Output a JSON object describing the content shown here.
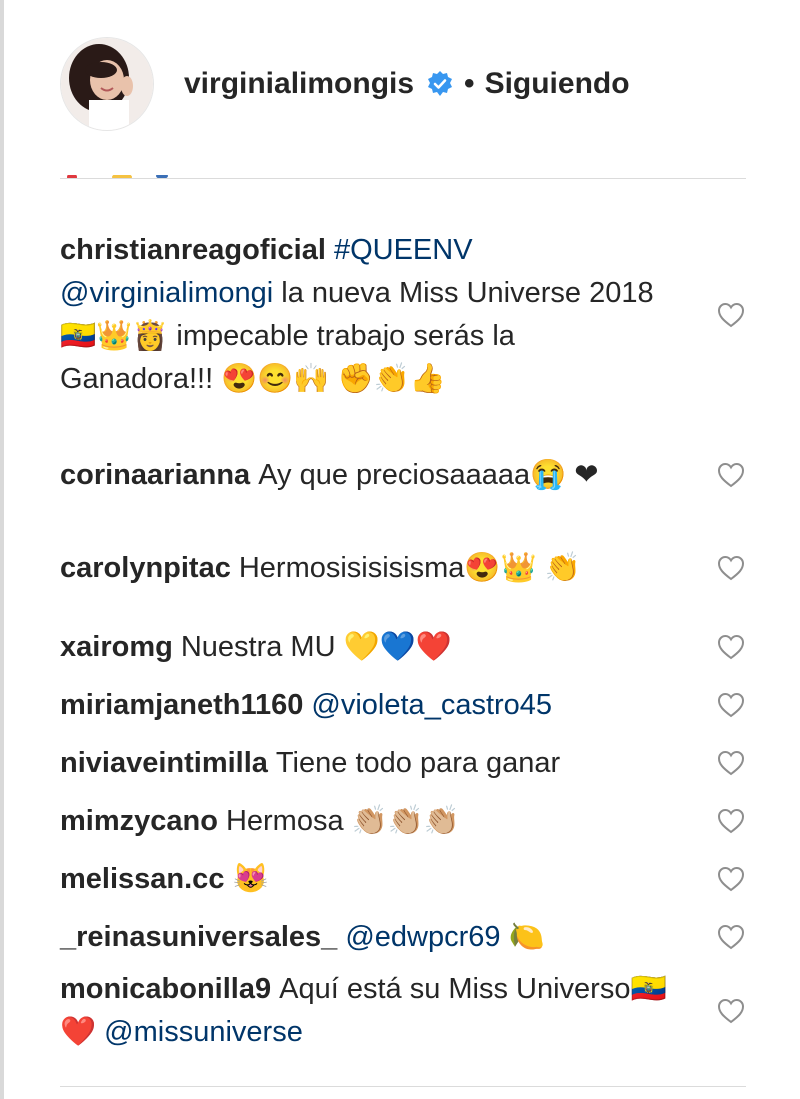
{
  "header": {
    "username": "virginialimongis",
    "separator": "•",
    "follow_status": "Siguiendo"
  },
  "comments": [
    {
      "user": "christianreagoficial",
      "parts": [
        {
          "type": "mention",
          "text": "#QUEENV"
        },
        {
          "type": "text",
          "text": " "
        },
        {
          "type": "mention",
          "text": "@virginialimongi"
        },
        {
          "type": "text",
          "text": " la nueva Miss Universe 2018 🇪🇨👑👸 impecable trabajo serás la Ganadora!!! 😍😊🙌 ✊👏👍"
        }
      ]
    },
    {
      "user": "corinaarianna",
      "parts": [
        {
          "type": "text",
          "text": "Ay que preciosaaaaa😭 ❤"
        }
      ]
    },
    {
      "user": "carolynpitac",
      "parts": [
        {
          "type": "text",
          "text": "Hermosisisisisma😍👑 👏"
        }
      ]
    },
    {
      "user": "xairomg",
      "parts": [
        {
          "type": "text",
          "text": "Nuestra MU 💛💙❤️"
        }
      ]
    },
    {
      "user": "miriamjaneth1160",
      "parts": [
        {
          "type": "mention",
          "text": "@violeta_castro45"
        }
      ]
    },
    {
      "user": "niviaveintimilla",
      "parts": [
        {
          "type": "text",
          "text": "Tiene todo para ganar"
        }
      ]
    },
    {
      "user": "mimzycano",
      "parts": [
        {
          "type": "text",
          "text": "Hermosa 👏🏼👏🏼👏🏼"
        }
      ]
    },
    {
      "user": "melissan.cc",
      "parts": [
        {
          "type": "text",
          "text": "😻"
        }
      ]
    },
    {
      "user": "_reinasuniversales_",
      "parts": [
        {
          "type": "mention",
          "text": "@edwpcr69"
        },
        {
          "type": "text",
          "text": " 🍋"
        }
      ]
    },
    {
      "user": "monicabonilla9",
      "parts": [
        {
          "type": "text",
          "text": "Aquí está su Miss Universo🇪🇨❤️ "
        },
        {
          "type": "mention",
          "text": "@missuniverse"
        }
      ]
    }
  ],
  "colors": {
    "text": "#262626",
    "mention": "#003569",
    "verified": "#3897f0",
    "divider": "#dbdbdb",
    "heart_outline": "#8e8e8e"
  },
  "icons": {
    "verified": "verified-badge-icon",
    "like": "heart-outline-icon"
  }
}
